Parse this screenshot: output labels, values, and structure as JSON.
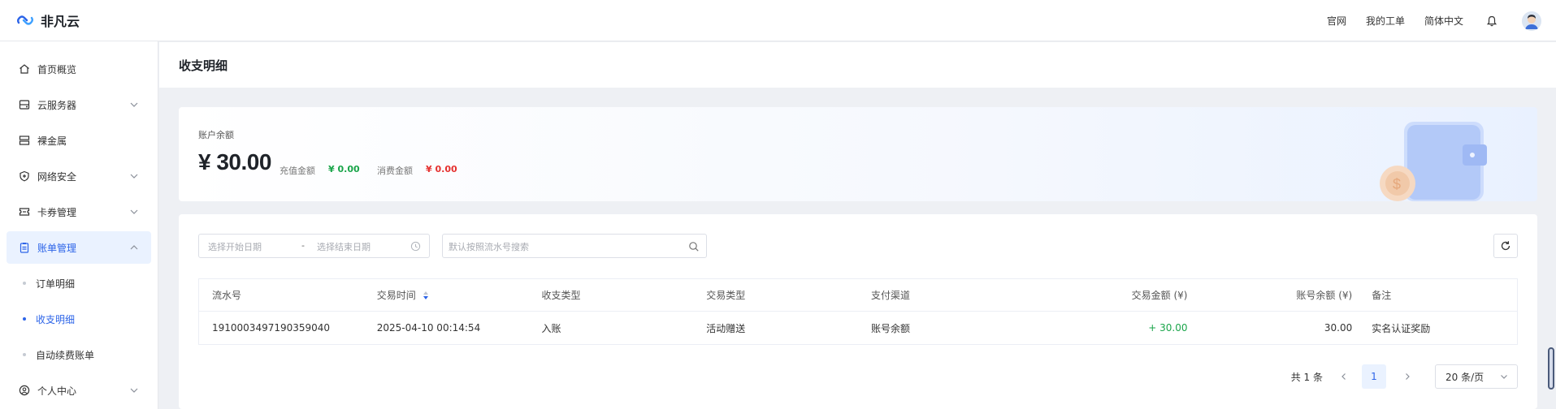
{
  "header": {
    "brand": "非凡云",
    "links": [
      "官网",
      "我的工单",
      "简体中文"
    ]
  },
  "sidebar": {
    "items": [
      {
        "label": "首页概览",
        "icon": "home-icon"
      },
      {
        "label": "云服务器",
        "icon": "server-icon",
        "expandable": true
      },
      {
        "label": "裸金属",
        "icon": "bare-metal-icon"
      },
      {
        "label": "网络安全",
        "icon": "shield-icon",
        "expandable": true
      },
      {
        "label": "卡券管理",
        "icon": "ticket-icon",
        "expandable": true
      },
      {
        "label": "账单管理",
        "icon": "bill-icon",
        "expanded": true,
        "active": true
      },
      {
        "label": "个人中心",
        "icon": "user-icon",
        "expandable": true
      }
    ],
    "sub_items": [
      {
        "label": "订单明细"
      },
      {
        "label": "收支明细",
        "active": true
      },
      {
        "label": "自动续费账单"
      }
    ]
  },
  "page": {
    "title": "收支明细"
  },
  "balance": {
    "label": "账户余额",
    "amount": "¥ 30.00",
    "recharge_label": "充值金额",
    "recharge_value": "¥ 0.00",
    "spend_label": "消费金额",
    "spend_value": "¥ 0.00",
    "colors": {
      "recharge": "#1aa54a",
      "spend": "#e5312f"
    }
  },
  "filters": {
    "start_placeholder": "选择开始日期",
    "separator": "-",
    "end_placeholder": "选择结束日期",
    "search_placeholder": "默认按照流水号搜索"
  },
  "table": {
    "headers": [
      "流水号",
      "交易时间",
      "收支类型",
      "交易类型",
      "支付渠道",
      "交易金额 (¥)",
      "账号余额 (¥)",
      "备注"
    ],
    "rows": [
      [
        "1910003497190359040",
        "2025-04-10 00:14:54",
        "入账",
        "活动赠送",
        "账号余额",
        "+ 30.00",
        "30.00",
        "实名认证奖励"
      ]
    ]
  },
  "pagination": {
    "total": "共 1 条",
    "current": "1",
    "page_size": "20 条/页"
  },
  "colors": {
    "accent": "#2c64e8",
    "positive": "#1aa54a",
    "negative": "#e5312f"
  }
}
